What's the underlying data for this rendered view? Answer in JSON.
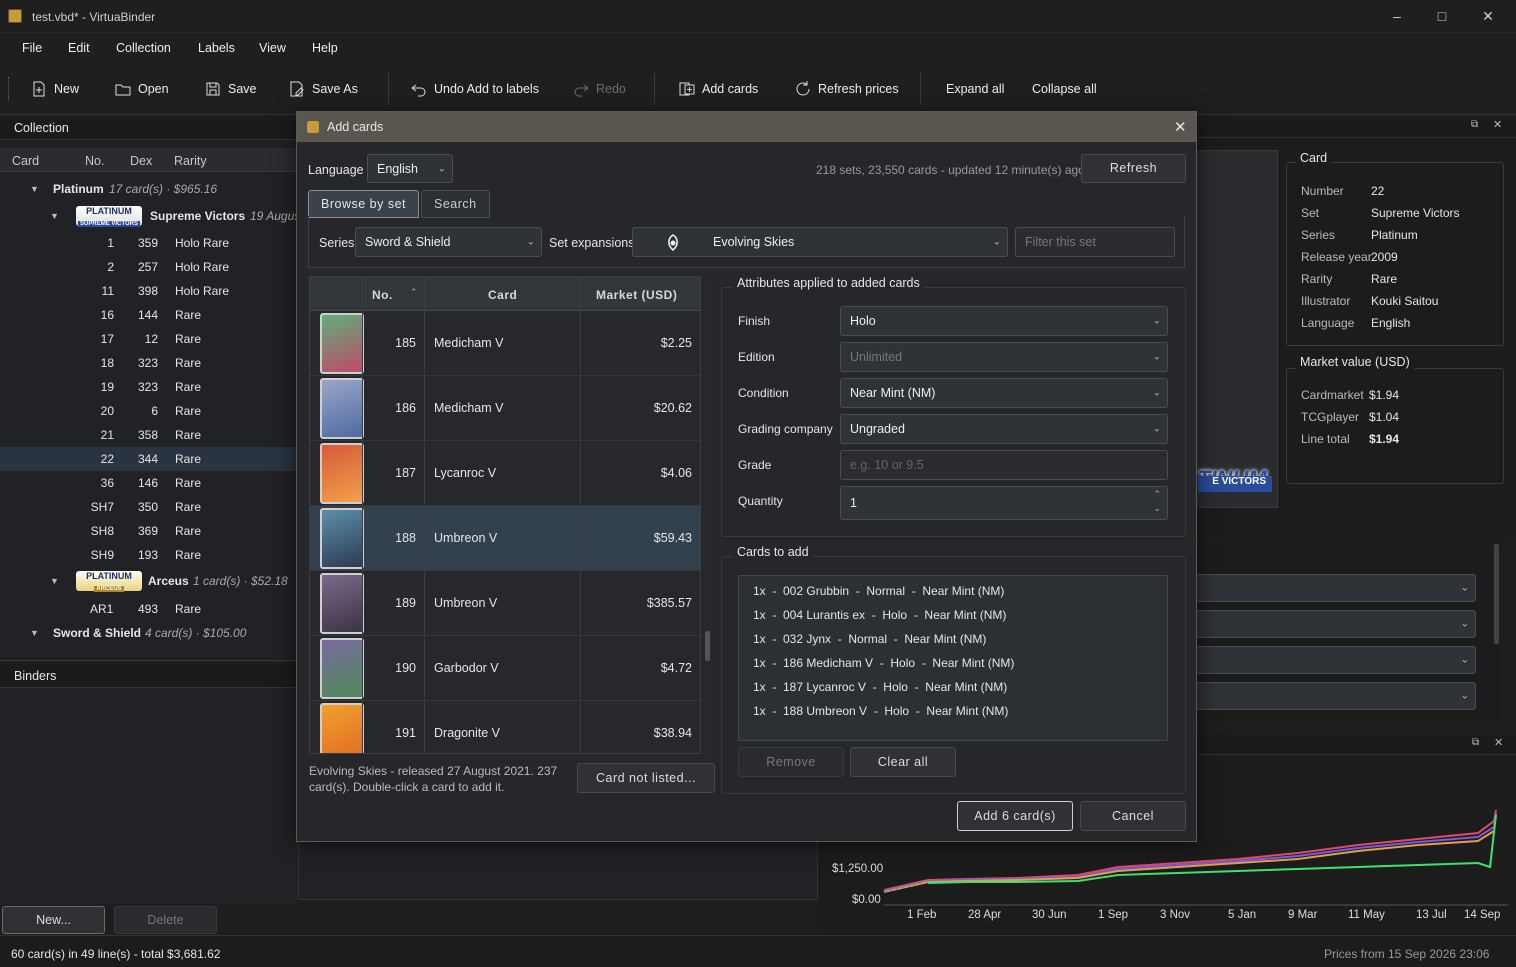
{
  "window": {
    "title": "test.vbd* - VirtuaBinder"
  },
  "menu": [
    "File",
    "Edit",
    "Collection",
    "Labels",
    "View",
    "Help"
  ],
  "toolbar": {
    "new": "New",
    "open": "Open",
    "save": "Save",
    "save_as": "Save As",
    "undo": "Undo Add to labels",
    "redo": "Redo",
    "add_cards": "Add cards",
    "refresh_prices": "Refresh prices",
    "expand_all": "Expand all",
    "collapse_all": "Collapse all"
  },
  "collection": {
    "title": "Collection",
    "columns": [
      "Card",
      "No.",
      "Dex",
      "Rarity"
    ],
    "groups": [
      {
        "name": "Platinum",
        "meta": "17 card(s) · $965.16"
      },
      {
        "name": "Supreme Victors",
        "meta": "19 Augus",
        "logo": "PLATINUM SUPREME VICTORS"
      },
      {
        "name": "Arceus",
        "meta": "1 card(s) · $52.18",
        "logo": "PLATINUM ARCEUS"
      },
      {
        "name": "Sword & Shield",
        "meta": "4 card(s) · $105.00"
      }
    ],
    "rows": [
      {
        "no": "1",
        "dex": "359",
        "rarity": "Holo Rare"
      },
      {
        "no": "2",
        "dex": "257",
        "rarity": "Holo Rare"
      },
      {
        "no": "11",
        "dex": "398",
        "rarity": "Holo Rare"
      },
      {
        "no": "16",
        "dex": "144",
        "rarity": "Rare"
      },
      {
        "no": "17",
        "dex": "12",
        "rarity": "Rare"
      },
      {
        "no": "18",
        "dex": "323",
        "rarity": "Rare"
      },
      {
        "no": "19",
        "dex": "323",
        "rarity": "Rare"
      },
      {
        "no": "20",
        "dex": "6",
        "rarity": "Rare"
      },
      {
        "no": "21",
        "dex": "358",
        "rarity": "Rare"
      },
      {
        "no": "22",
        "dex": "344",
        "rarity": "Rare"
      },
      {
        "no": "36",
        "dex": "146",
        "rarity": "Rare"
      },
      {
        "no": "SH7",
        "dex": "350",
        "rarity": "Rare"
      },
      {
        "no": "SH8",
        "dex": "369",
        "rarity": "Rare"
      },
      {
        "no": "SH9",
        "dex": "193",
        "rarity": "Rare"
      },
      {
        "no": "AR1",
        "dex": "493",
        "rarity": "Rare"
      }
    ]
  },
  "binders": {
    "title": "Binders",
    "new_btn": "New...",
    "delete_btn": "Delete"
  },
  "status": {
    "left": "60 card(s) in 49 line(s)  -  total $3,681.62",
    "right": "Prices from 15 Sep 2026 23:06"
  },
  "card_info": {
    "title": "Card",
    "fields": [
      {
        "k": "Number",
        "v": "22"
      },
      {
        "k": "Set",
        "v": "Supreme Victors"
      },
      {
        "k": "Series",
        "v": "Platinum"
      },
      {
        "k": "Release year",
        "v": "2009"
      },
      {
        "k": "Rarity",
        "v": "Rare"
      },
      {
        "k": "Illustrator",
        "v": "Kouki Saitou"
      },
      {
        "k": "Language",
        "v": "English"
      }
    ],
    "market_title": "Market value (USD)",
    "market": [
      {
        "k": "Cardmarket",
        "v": "$1.94"
      },
      {
        "k": "TCGplayer",
        "v": "$1.04"
      },
      {
        "k": "Line total",
        "v": "$1.94"
      }
    ],
    "logo_text": "TINUM",
    "logo_sub": "E VICTORS"
  },
  "chart": {
    "y_labels": [
      "$1,250.00",
      "$0.00"
    ],
    "x_labels": [
      "1 Feb",
      "28 Apr",
      "30 Jun",
      "1 Sep",
      "3 Nov",
      "5 Jan",
      "9 Mar",
      "11 May",
      "13 Jul",
      "14 Sep"
    ]
  },
  "dialog": {
    "title": "Add cards",
    "language_label": "Language",
    "language": "English",
    "info": "218 sets, 23,550 cards - updated 12 minute(s) ago",
    "refresh": "Refresh",
    "tabs": [
      "Browse by set",
      "Search"
    ],
    "series_label": "Series",
    "series": "Sword & Shield",
    "set_label": "Set expansions",
    "set": "Evolving Skies",
    "filter_placeholder": "Filter this set",
    "grid_cols": [
      "No.",
      "Card",
      "Market (USD)"
    ],
    "grid": [
      {
        "no": "185",
        "card": "Medicham V",
        "price": "$2.25",
        "c1": "#5fae7a",
        "c2": "#c04a6a"
      },
      {
        "no": "186",
        "card": "Medicham V",
        "price": "$20.62",
        "c1": "#9aa6c8",
        "c2": "#4f6aa0"
      },
      {
        "no": "187",
        "card": "Lycanroc V",
        "price": "$4.06",
        "c1": "#d65a3a",
        "c2": "#f2a04a"
      },
      {
        "no": "188",
        "card": "Umbreon V",
        "price": "$59.43",
        "c1": "#5d8fa8",
        "c2": "#2c3b52"
      },
      {
        "no": "189",
        "card": "Umbreon V",
        "price": "$385.57",
        "c1": "#7a6a8a",
        "c2": "#3b3344"
      },
      {
        "no": "190",
        "card": "Garbodor V",
        "price": "$4.72",
        "c1": "#7a6aa0",
        "c2": "#4f8a5a"
      },
      {
        "no": "191",
        "card": "Dragonite V",
        "price": "$38.94",
        "c1": "#f0a030",
        "c2": "#e06a20"
      }
    ],
    "footer_text": "Evolving Skies - released 27 August 2021. 237 card(s). Double-click a card to add it.",
    "card_not_listed": "Card not listed...",
    "attr_title": "Attributes applied to added cards",
    "attrs": [
      {
        "label": "Finish",
        "value": "Holo"
      },
      {
        "label": "Edition",
        "value": "Unlimited"
      },
      {
        "label": "Condition",
        "value": "Near Mint (NM)"
      },
      {
        "label": "Grading company",
        "value": "Ungraded"
      },
      {
        "label": "Grade",
        "value": ""
      },
      {
        "label": "Quantity",
        "value": "1"
      }
    ],
    "grade_placeholder": "e.g. 10 or 9.5",
    "cards_to_add_title": "Cards to add",
    "cards_to_add": [
      "1x  -  002 Grubbin  -  Normal  -  Near Mint (NM)",
      "1x  -  004 Lurantis ex  -  Holo  -  Near Mint (NM)",
      "1x  -  032 Jynx  -  Normal  -  Near Mint (NM)",
      "1x  -  186 Medicham V  -  Holo  -  Near Mint (NM)",
      "1x  -  187 Lycanroc V  -  Holo  -  Near Mint (NM)",
      "1x  -  188 Umbreon V  -  Holo  -  Near Mint (NM)"
    ],
    "remove": "Remove",
    "clear_all": "Clear all",
    "add_btn": "Add 6 card(s)",
    "cancel": "Cancel"
  }
}
